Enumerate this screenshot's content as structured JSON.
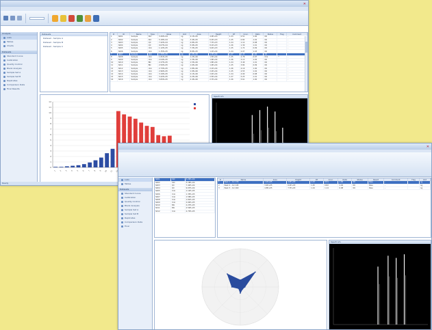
{
  "window1": {
    "title": "",
    "ribbon_tabs": [
      "",
      "",
      ""
    ],
    "nav": {
      "top_header": "Analysis",
      "top_items": [
        "Lists",
        "Tables",
        "Charts"
      ],
      "bottom_header": "Datasets",
      "bottom_items": [
        "Standard Curve",
        "Calibration",
        "Quality Control",
        "Blank Analysis",
        "Sample Set A",
        "Sample Set B",
        "Replicates",
        "Comparison Data",
        "Final Results"
      ]
    },
    "list_panel": {
      "header": "Datasets",
      "items": [
        "Dataset - Sample A",
        "Dataset - Sample B",
        "Dataset - Sample C"
      ]
    },
    "table": {
      "columns": [
        "#",
        "ID",
        "Name",
        "Type",
        "Value",
        "Unit",
        "Area",
        "Height",
        "RT",
        "Conc.",
        "Ratio",
        "Status",
        "Flag",
        "Comment"
      ],
      "rows": [
        [
          "1",
          "S001",
          "Sample",
          "Std",
          "3.26E+04",
          "ng",
          "2.1E+05",
          "4.9E+03",
          "1.23",
          "0.51",
          "1.00",
          "OK",
          "",
          "-"
        ],
        [
          "2",
          "S002",
          "Sample",
          "Std",
          "5.18E+04",
          "ng",
          "3.4E+05",
          "6.2E+03",
          "1.25",
          "0.82",
          "1.02",
          "OK",
          "",
          "-"
        ],
        [
          "3",
          "S003",
          "Sample",
          "QC",
          "7.42E+04",
          "ng",
          "4.8E+05",
          "7.7E+03",
          "1.24",
          "1.14",
          "0.98",
          "OK",
          "",
          "-"
        ],
        [
          "4",
          "S004",
          "Sample",
          "QC",
          "9.07E+04",
          "ng",
          "5.9E+05",
          "8.1E+03",
          "1.26",
          "1.39",
          "1.01",
          "OK",
          "",
          "-"
        ],
        [
          "5",
          "S005",
          "Sample",
          "Unk",
          "1.12E+05",
          "ng",
          "7.3E+05",
          "9.4E+03",
          "1.25",
          "1.72",
          "0.99",
          "OK",
          "",
          "-"
        ],
        [
          "6",
          "S006",
          "Sample",
          "Unk",
          "1.35E+05",
          "ng",
          "8.8E+05",
          "1.1E+04",
          "1.24",
          "2.07",
          "1.03",
          "OK",
          "",
          "-"
        ],
        [
          "7",
          "S007",
          "Sample",
          "Unk",
          "1.58E+05",
          "ng",
          "1.0E+06",
          "1.3E+04",
          "1.27",
          "2.43",
          "1.00",
          "OK",
          "",
          "-"
        ],
        [
          "8",
          "S008",
          "Sample",
          "Unk",
          "1.81E+05",
          "ng",
          "1.2E+06",
          "1.5E+04",
          "1.25",
          "2.78",
          "0.97",
          "Chk",
          "*",
          "-"
        ],
        [
          "9",
          "S009",
          "Sample",
          "Unk",
          "2.04E+05",
          "ng",
          "1.3E+06",
          "1.6E+04",
          "1.26",
          "3.13",
          "1.02",
          "OK",
          "",
          "-"
        ],
        [
          "10",
          "S010",
          "Sample",
          "Blk",
          "2.27E+05",
          "ng",
          "1.5E+06",
          "1.8E+04",
          "1.24",
          "3.49",
          "1.01",
          "OK",
          "",
          "-"
        ],
        [
          "11",
          "S011",
          "Sample",
          "Blk",
          "2.50E+05",
          "ng",
          "1.6E+06",
          "1.9E+04",
          "1.25",
          "3.84",
          "0.99",
          "OK",
          "",
          "-"
        ],
        [
          "12",
          "S012",
          "Sample",
          "Unk",
          "2.73E+05",
          "ng",
          "1.8E+06",
          "2.1E+04",
          "1.26",
          "4.19",
          "1.00",
          "OK",
          "",
          "-"
        ],
        [
          "13",
          "S013",
          "Sample",
          "Unk",
          "2.96E+05",
          "ng",
          "1.9E+06",
          "2.2E+04",
          "1.25",
          "4.55",
          "1.02",
          "OK",
          "",
          "-"
        ],
        [
          "14",
          "S014",
          "Sample",
          "Unk",
          "3.19E+05",
          "ng",
          "2.1E+06",
          "2.4E+04",
          "1.24",
          "4.90",
          "0.98",
          "OK",
          "",
          "-"
        ],
        [
          "15",
          "S015",
          "Sample",
          "Unk",
          "3.42E+05",
          "ng",
          "2.2E+06",
          "2.5E+04",
          "1.27",
          "5.25",
          "1.01",
          "OK",
          "",
          "-"
        ],
        [
          "16",
          "S016",
          "Sample",
          "Unk",
          "3.65E+05",
          "ng",
          "2.4E+06",
          "2.7E+04",
          "1.26",
          "5.61",
          "1.00",
          "OK",
          "",
          "-"
        ]
      ]
    },
    "chart_title": "",
    "spectrum_header": "Spectrum",
    "status": "Ready"
  },
  "window2": {
    "nav": {
      "top_items": [
        "Lists",
        "Tables"
      ],
      "bottom_header": "Datasets",
      "bottom_items": [
        "Standard Curve",
        "Calibration",
        "Quality Control",
        "Blank Analysis",
        "Sample Set A",
        "Sample Set B",
        "Replicates",
        "Comparison Data",
        "Final"
      ]
    },
    "left_table": {
      "rows": [
        [
          "S001",
          "Std",
          "3.26E+04"
        ],
        [
          "S002",
          "Std",
          "5.18E+04"
        ],
        [
          "S003",
          "QC",
          "7.42E+04"
        ],
        [
          "S004",
          "QC",
          "9.07E+04"
        ],
        [
          "S005",
          "Unk",
          "1.12E+05"
        ],
        [
          "S006",
          "Unk",
          "1.35E+05"
        ],
        [
          "S007",
          "Unk",
          "1.58E+05"
        ],
        [
          "S008",
          "Unk",
          "1.81E+05"
        ],
        [
          "S009",
          "Unk",
          "2.04E+05"
        ],
        [
          "S010",
          "Blk",
          "2.27E+05"
        ],
        [
          "S011",
          "Blk",
          "2.50E+05"
        ],
        [
          "S012",
          "Unk",
          "2.73E+05"
        ]
      ]
    },
    "right_table": {
      "columns": [
        "#",
        "Name",
        "Area",
        "Height",
        "RT",
        "Conc.",
        "Ratio",
        "Status",
        "Result",
        "Comment",
        "Flag",
        "Unit"
      ],
      "rows": [
        [
          "1",
          "Peak 1 - mz 130",
          "2.1E+05",
          "4.9E+03",
          "1.23",
          "0.51",
          "1.00",
          "OK",
          "Pass",
          "-",
          "",
          "ng"
        ],
        [
          "2",
          "Peak 2 - mz 145",
          "3.4E+05",
          "6.2E+03",
          "1.25",
          "0.82",
          "1.02",
          "OK",
          "Pass",
          "-",
          "",
          "ng"
        ],
        [
          "3",
          "Peak 3 - mz 160",
          "4.8E+05",
          "7.7E+03",
          "1.24",
          "1.14",
          "0.98",
          "OK",
          "Pass",
          "-",
          "",
          "ng"
        ]
      ]
    },
    "chart_title": "",
    "spectrum_header": "Spectrum"
  },
  "chart_data": [
    {
      "type": "bar",
      "title": "",
      "categories": [
        "1",
        "2",
        "3",
        "4",
        "5",
        "6",
        "7",
        "8",
        "9",
        "10",
        "11",
        "12",
        "13",
        "14",
        "15",
        "16",
        "17",
        "18",
        "19",
        "20",
        "21",
        "22",
        "23",
        "24"
      ],
      "series": [
        {
          "values": [
            0.1,
            0.1,
            0.2,
            0.3,
            0.4,
            0.6,
            0.9,
            1.3,
            1.8,
            2.6,
            3.4,
            0,
            0,
            0,
            0,
            0,
            0,
            0,
            0,
            0,
            0,
            0,
            0,
            0
          ],
          "color": "#2d4da3"
        },
        {
          "values": [
            0,
            0,
            0,
            0,
            0,
            0,
            0,
            0,
            0,
            0,
            0,
            10.3,
            9.7,
            9.3,
            8.9,
            8.2,
            7.6,
            7.4,
            5.9,
            5.7,
            5.8,
            0,
            0,
            0
          ],
          "color": "#e03e3b"
        }
      ],
      "ylim": [
        0,
        12
      ],
      "yticks": [
        "0",
        "1",
        "2",
        "3",
        "4",
        "5",
        "6",
        "7",
        "8",
        "9",
        "10",
        "11",
        "12"
      ],
      "grid": true,
      "legend": "top-right"
    },
    {
      "type": "radar",
      "title": "",
      "values": [
        0.18,
        0.55,
        0.12,
        0.08,
        0.16,
        0.06,
        0.22,
        0.48
      ],
      "color": "#2a4c9e",
      "rmax": 1
    }
  ],
  "spectrum1": {
    "peaks": [
      [
        0.42,
        0.88
      ],
      [
        0.5,
        0.95
      ],
      [
        0.58,
        1.0
      ],
      [
        0.66,
        0.93
      ],
      [
        0.74,
        0.7
      ]
    ]
  },
  "spectrum2": {
    "peaks": [
      [
        0.48,
        0.8
      ],
      [
        0.58,
        0.95
      ],
      [
        0.66,
        0.92
      ],
      [
        0.74,
        0.97
      ]
    ]
  }
}
